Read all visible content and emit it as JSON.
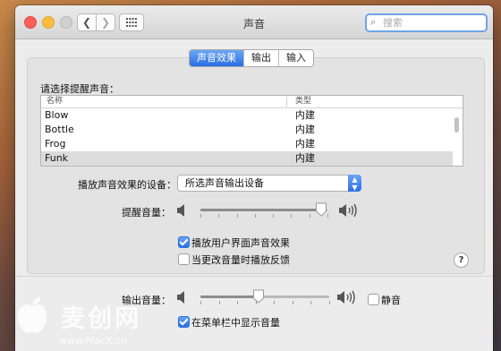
{
  "window": {
    "title": "声音",
    "search_placeholder": "搜索"
  },
  "tabs": [
    {
      "label": "声音效果",
      "active": true
    },
    {
      "label": "输出",
      "active": false
    },
    {
      "label": "输入",
      "active": false
    }
  ],
  "sound_effects": {
    "choose_label": "请选择提醒声音：",
    "table": {
      "columns": [
        "名称",
        "类型"
      ],
      "rows": [
        {
          "name": "Blow",
          "type": "内建",
          "selected": false
        },
        {
          "name": "Bottle",
          "type": "内建",
          "selected": false
        },
        {
          "name": "Frog",
          "type": "内建",
          "selected": false
        },
        {
          "name": "Funk",
          "type": "内建",
          "selected": true
        }
      ]
    },
    "device_label": "播放声音效果的设备：",
    "device_value": "所选声音输出设备",
    "alert_volume_label": "提醒音量：",
    "alert_volume_level": 0.95,
    "checkbox_ui_sounds": {
      "label": "播放用户界面声音效果",
      "checked": true
    },
    "checkbox_feedback": {
      "label": "当更改音量时播放反馈",
      "checked": false
    },
    "help": "?"
  },
  "output": {
    "volume_label": "输出音量：",
    "volume_level": 0.45,
    "mute_label": "静音",
    "mute_checked": false,
    "show_in_menubar_label": "在菜单栏中显示音量",
    "show_in_menubar_checked": true
  },
  "watermark": {
    "text": "麦创网",
    "url": "www.MacX.cn"
  },
  "colors": {
    "accent": "#2b6fe3",
    "close": "#fc605b",
    "minimize": "#fdbc40"
  }
}
